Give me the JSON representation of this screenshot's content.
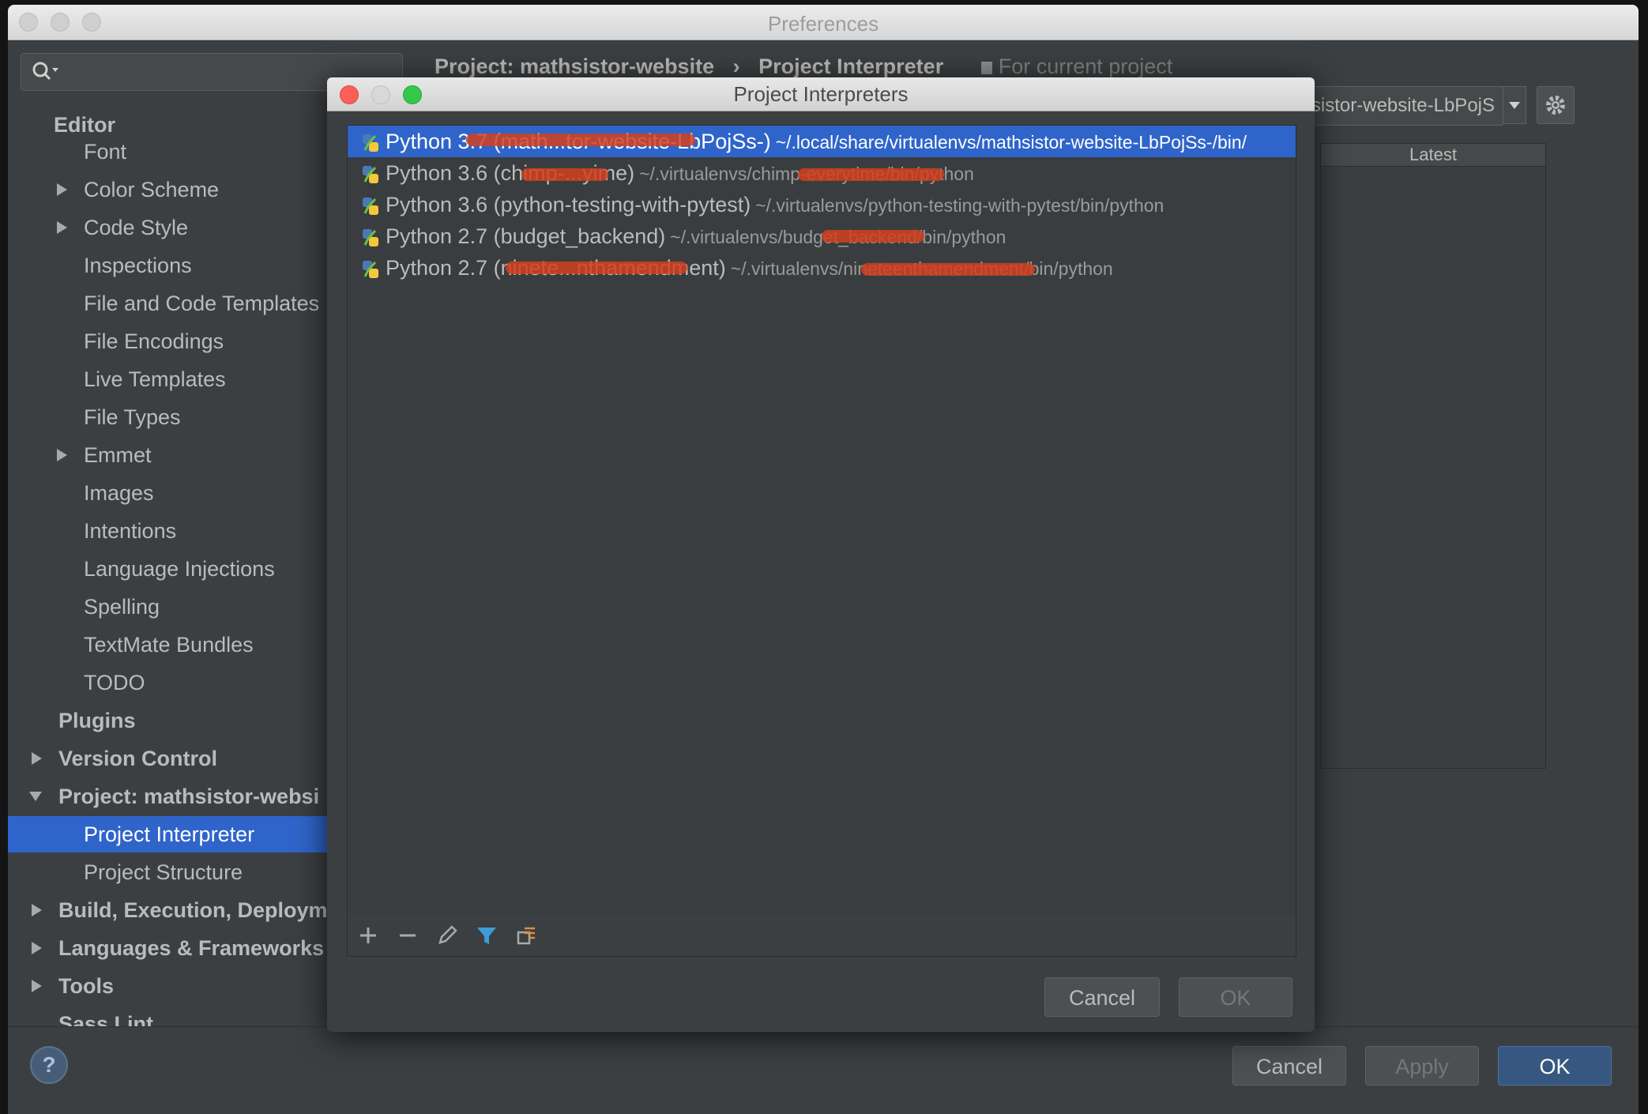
{
  "window": {
    "title": "Preferences"
  },
  "sidebar": {
    "items": [
      {
        "label": "Editor"
      },
      {
        "label": "Font"
      },
      {
        "label": "Color Scheme"
      },
      {
        "label": "Code Style"
      },
      {
        "label": "Inspections"
      },
      {
        "label": "File and Code Templates"
      },
      {
        "label": "File Encodings"
      },
      {
        "label": "Live Templates"
      },
      {
        "label": "File Types"
      },
      {
        "label": "Emmet"
      },
      {
        "label": "Images"
      },
      {
        "label": "Intentions"
      },
      {
        "label": "Language Injections"
      },
      {
        "label": "Spelling"
      },
      {
        "label": "TextMate Bundles"
      },
      {
        "label": "TODO"
      },
      {
        "label": "Plugins"
      },
      {
        "label": "Version Control"
      },
      {
        "label": "Project: mathsistor-websi"
      },
      {
        "label": "Project Interpreter"
      },
      {
        "label": "Project Structure"
      },
      {
        "label": "Build, Execution, Deploym"
      },
      {
        "label": "Languages & Frameworks"
      },
      {
        "label": "Tools"
      },
      {
        "label": "Sass Lint"
      }
    ]
  },
  "main": {
    "breadcrumb": {
      "project": "Project: mathsistor-website",
      "separator": "›",
      "page": "Project Interpreter",
      "scope": "For current project"
    },
    "interpreter_value": "athsistor-website-LbPojS",
    "packages_header": "Latest"
  },
  "dialog": {
    "title": "Project Interpreters",
    "interpreters": [
      {
        "version": "Python 3.7 (math...tor-website-LbPojSs-)",
        "path": "~/.local/share/virtualenvs/mathsistor-website-LbPojSs-/bin/",
        "selected": true
      },
      {
        "version": "Python 3.6 (chimp-...yime)",
        "path": "~/.virtualenvs/chimp-everytime/bin/python",
        "selected": false
      },
      {
        "version": "Python 3.6 (python-testing-with-pytest)",
        "path": "~/.virtualenvs/python-testing-with-pytest/bin/python",
        "selected": false
      },
      {
        "version": "Python 2.7 (budget_backend)",
        "path": "~/.virtualenvs/budget_backend/bin/python",
        "selected": false
      },
      {
        "version": "Python 2.7 (ninete...nthamendment)",
        "path": "~/.virtualenvs/nineteenthamendment/bin/python",
        "selected": false
      }
    ],
    "buttons": {
      "cancel": "Cancel",
      "ok": "OK"
    }
  },
  "footer": {
    "help": "?",
    "cancel": "Cancel",
    "apply": "Apply",
    "ok": "OK"
  },
  "colors": {
    "selection": "#2f65ca",
    "redaction": "#d2401f",
    "panel": "#3c3f41"
  }
}
